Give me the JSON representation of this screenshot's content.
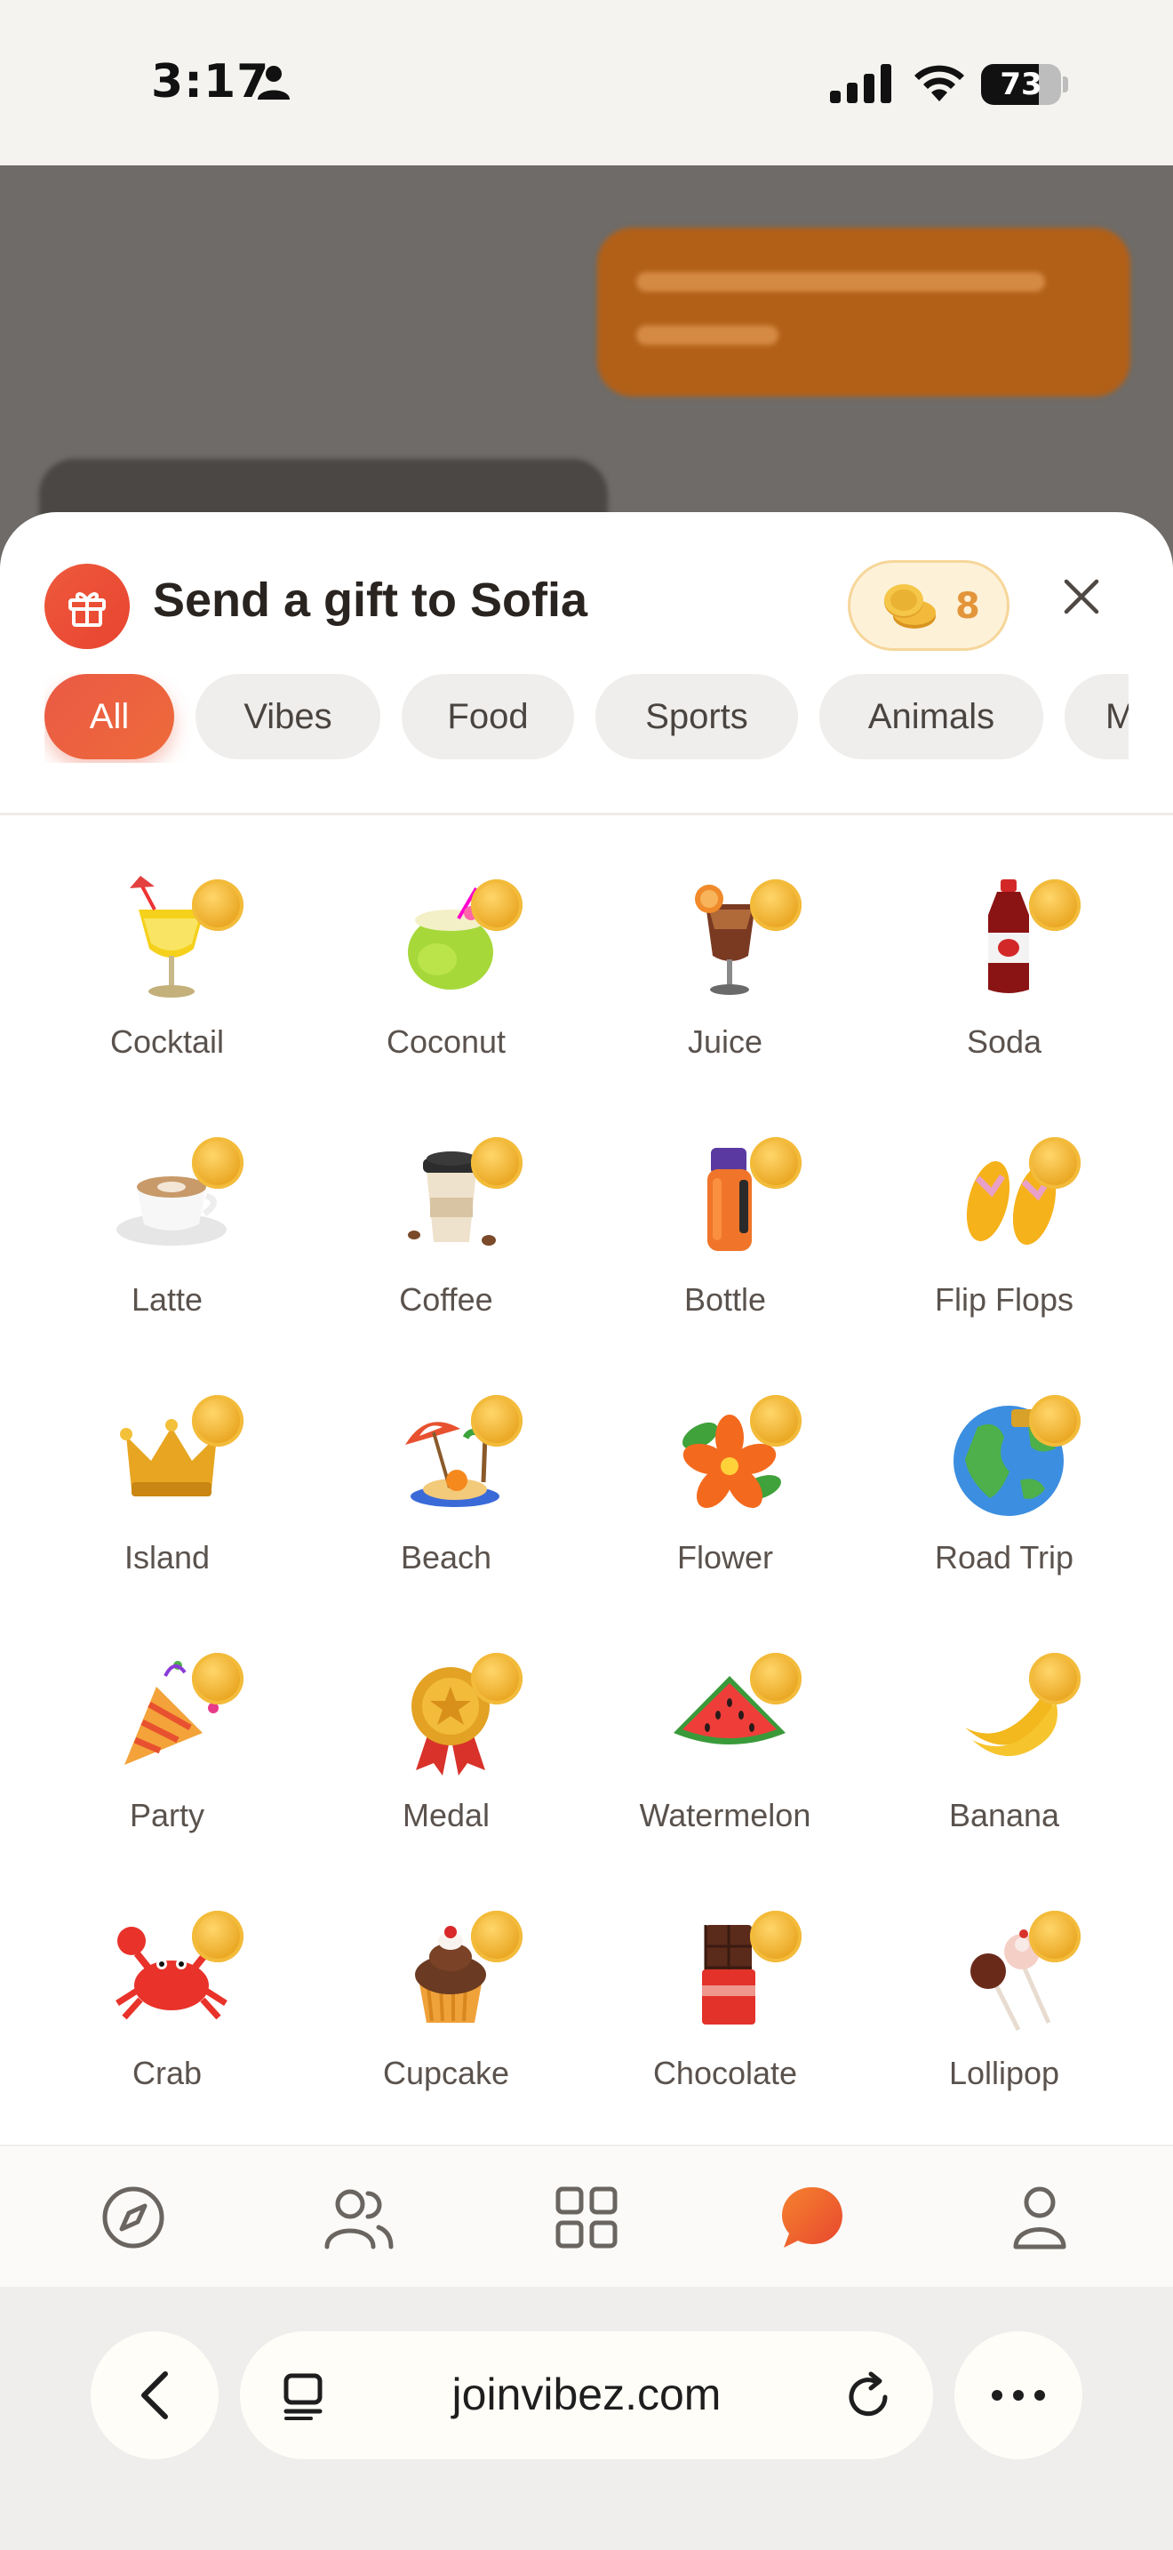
{
  "status_bar": {
    "time": "3:17",
    "battery": "73"
  },
  "sheet": {
    "title": "Send a gift to Sofia",
    "coin_balance": "8",
    "tabs": [
      {
        "label": "All",
        "active": true
      },
      {
        "label": "Vibes",
        "active": false
      },
      {
        "label": "Food",
        "active": false
      },
      {
        "label": "Sports",
        "active": false
      },
      {
        "label": "Animals",
        "active": false
      },
      {
        "label": "M",
        "active": false
      }
    ],
    "gifts": [
      {
        "label": "Cocktail",
        "icon": "cocktail-icon"
      },
      {
        "label": "Coconut",
        "icon": "coconut-icon"
      },
      {
        "label": "Juice",
        "icon": "juice-icon"
      },
      {
        "label": "Soda",
        "icon": "soda-icon"
      },
      {
        "label": "Latte",
        "icon": "latte-icon"
      },
      {
        "label": "Coffee",
        "icon": "coffee-icon"
      },
      {
        "label": "Bottle",
        "icon": "bottle-icon"
      },
      {
        "label": "Flip Flops",
        "icon": "flip-flops-icon"
      },
      {
        "label": "Island",
        "icon": "crown-icon"
      },
      {
        "label": "Beach",
        "icon": "beach-icon"
      },
      {
        "label": "Flower",
        "icon": "flower-icon"
      },
      {
        "label": "Road Trip",
        "icon": "globe-icon"
      },
      {
        "label": "Party",
        "icon": "party-popper-icon"
      },
      {
        "label": "Medal",
        "icon": "medal-icon"
      },
      {
        "label": "Watermelon",
        "icon": "watermelon-icon"
      },
      {
        "label": "Banana",
        "icon": "banana-icon"
      },
      {
        "label": "Crab",
        "icon": "crab-icon"
      },
      {
        "label": "Cupcake",
        "icon": "cupcake-icon"
      },
      {
        "label": "Chocolate",
        "icon": "chocolate-icon"
      },
      {
        "label": "Lollipop",
        "icon": "lollipop-icon"
      }
    ]
  },
  "nav": {
    "items": [
      "compass-icon",
      "people-icon",
      "grid-icon",
      "chat-icon",
      "profile-icon"
    ]
  },
  "browser": {
    "url": "joinvibez.com"
  },
  "colors": {
    "accent": "#E8503A",
    "coin": "#E9A520"
  }
}
